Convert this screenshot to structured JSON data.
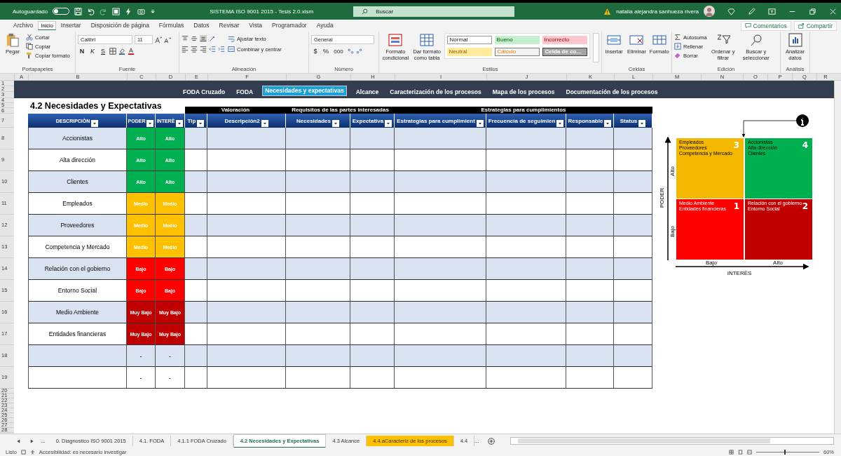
{
  "titlebar": {
    "autosave_label": "Autoguardado",
    "autosave_on": false,
    "title": "SISTEMA ISO 9001 2015 - Tesis 2.0.xlsm",
    "search_placeholder": "Buscar",
    "user": "natalia alejandra sanhueza rivera"
  },
  "menu": {
    "tabs": [
      {
        "label": "Archivo",
        "selected": false
      },
      {
        "label": "Inicio",
        "selected": true
      },
      {
        "label": "Insertar",
        "selected": false
      },
      {
        "label": "Disposición de página",
        "selected": false
      },
      {
        "label": "Fórmulas",
        "selected": false
      },
      {
        "label": "Datos",
        "selected": false
      },
      {
        "label": "Revisar",
        "selected": false
      },
      {
        "label": "Vista",
        "selected": false
      },
      {
        "label": "Programador",
        "selected": false
      },
      {
        "label": "Ayuda",
        "selected": false
      }
    ],
    "comments": "Comentarios",
    "share": "Compartir"
  },
  "ribbon": {
    "clipboard": {
      "paste": "Pegar",
      "cut": "Cortar",
      "copy": "Copiar",
      "format_painter": "Copiar formato",
      "label": "Portapapeles"
    },
    "font": {
      "name": "Calibri",
      "size": "11",
      "bold": "N",
      "italic": "K",
      "underline": "S",
      "label": "Fuente"
    },
    "alignment": {
      "wrap": "Ajustar texto",
      "merge": "Combinar y centrar",
      "label": "Alineación"
    },
    "number": {
      "format": "General",
      "currency": "$",
      "percent": "%",
      "thousands": "000",
      "label": "Número"
    },
    "styles": {
      "conditional": "Formato condicional",
      "as_table": "Dar formato como tabla",
      "label": "Estilos",
      "cells": [
        {
          "label": "Normal",
          "kind": "normal"
        },
        {
          "label": "Bueno",
          "kind": "good"
        },
        {
          "label": "Incorrecto",
          "kind": "bad"
        },
        {
          "label": "Neutral",
          "kind": "neutral"
        },
        {
          "label": "Cálculo",
          "kind": "calc"
        },
        {
          "label": "Celda de co...",
          "kind": "check"
        }
      ]
    },
    "cells": {
      "insert": "Insertar",
      "delete": "Eliminar",
      "format": "Formato",
      "label": "Celdas"
    },
    "editing": {
      "autosum": "Autosuma",
      "fill": "Rellenar",
      "clear": "Borrar",
      "sort": "Ordenar y filtrar",
      "find": "Buscar y seleccionar",
      "label": "Edición"
    },
    "analysis": {
      "analyze": "Analizar datos",
      "label": "Análisis"
    }
  },
  "column_letters": [
    "A",
    "B",
    "C",
    "D",
    "E",
    "F",
    "G",
    "H",
    "I",
    "J",
    "K",
    "L",
    "M",
    "N",
    "O",
    "P",
    "Q",
    "R"
  ],
  "row_numbers": [
    "1",
    "2",
    "3",
    "4",
    "5",
    "6",
    "7",
    "8",
    "9",
    "10",
    "11",
    "12",
    "13",
    "14",
    "15",
    "16",
    "17",
    "18",
    "19",
    "20",
    "21",
    "22",
    "23",
    "24",
    "25",
    "26",
    "27",
    "28"
  ],
  "nav": [
    {
      "label": "FODA Cruzado",
      "selected": false
    },
    {
      "label": "FODA",
      "selected": false
    },
    {
      "label": "Necesidades y expectativas",
      "selected": true
    },
    {
      "label": "Alcance",
      "selected": false
    },
    {
      "label": "Caracterización de los procesos",
      "selected": false
    },
    {
      "label": "Mapa de los procesos",
      "selected": false
    },
    {
      "label": "Documentación de los procesos",
      "selected": false
    }
  ],
  "heading": "4.2 Necesidades y Expectativas",
  "groups": [
    "Valoración",
    "Requisitos de las partes interesadas",
    "Estrategias para cumplimientos"
  ],
  "columns": [
    "DESCRIPCIÒN",
    "PODER",
    "INTERÈ",
    "Tip",
    "Descripciòn2",
    "Necesidades",
    "Expectativa",
    "Estrategias para cumplimient",
    "Frecuencia de seguimien",
    "Responsable",
    "Status"
  ],
  "rows": [
    {
      "description": "Accionistas",
      "poder": {
        "text": "Alto",
        "kind": "alto"
      },
      "interes": {
        "text": "Alto",
        "kind": "alto"
      }
    },
    {
      "description": "Alta dirección",
      "poder": {
        "text": "Alto",
        "kind": "alto"
      },
      "interes": {
        "text": "Alto",
        "kind": "alto"
      }
    },
    {
      "description": "Clientes",
      "poder": {
        "text": "Alto",
        "kind": "alto"
      },
      "interes": {
        "text": "Alto",
        "kind": "alto"
      }
    },
    {
      "description": "Empleados",
      "poder": {
        "text": "Medio",
        "kind": "medio"
      },
      "interes": {
        "text": "Medio",
        "kind": "medio"
      }
    },
    {
      "description": "Proveedores",
      "poder": {
        "text": "Medio",
        "kind": "medio"
      },
      "interes": {
        "text": "Medio",
        "kind": "medio"
      }
    },
    {
      "description": "Competencia y Mercado",
      "poder": {
        "text": "Medio",
        "kind": "medio"
      },
      "interes": {
        "text": "Medio",
        "kind": "medio"
      }
    },
    {
      "description": "Relación con el gobierno",
      "poder": {
        "text": "Bajo",
        "kind": "bajo"
      },
      "interes": {
        "text": "Bajo",
        "kind": "bajo"
      }
    },
    {
      "description": "Entorno Social",
      "poder": {
        "text": "Bajo",
        "kind": "bajo"
      },
      "interes": {
        "text": "Bajo",
        "kind": "bajo"
      }
    },
    {
      "description": "Medio Ambiente",
      "poder": {
        "text": "Muy Bajo",
        "kind": "muy_bajo"
      },
      "interes": {
        "text": "Muy Bajo",
        "kind": "muy_bajo"
      }
    },
    {
      "description": "Entidades financieras",
      "poder": {
        "text": "Muy Bajo",
        "kind": "muy_bajo"
      },
      "interes": {
        "text": "Muy Bajo",
        "kind": "muy_bajo"
      }
    },
    {
      "poder": {
        "text": "-",
        "kind": "none"
      },
      "interes": {
        "text": "-",
        "kind": "none"
      }
    },
    {
      "poder": {
        "text": "-",
        "kind": "none"
      },
      "interes": {
        "text": "-",
        "kind": "none"
      }
    }
  ],
  "matrix": {
    "y_axis": "PODER",
    "y_high": "Alto",
    "y_low": "Bajo",
    "x_axis": "INTERÈS",
    "x_low": "Bajo",
    "x_high": "Alto",
    "quadrants": [
      {
        "number": "3",
        "color": "#f5b800",
        "items": [
          "Empleados",
          "Proveedores",
          "Competencia y Mercado"
        ]
      },
      {
        "number": "4",
        "color": "#00b050",
        "items": [
          "Accionistas",
          "Alta dirección",
          "Clientes"
        ]
      },
      {
        "number": "1",
        "color": "#ff0000",
        "items": [
          "Medio Ambiente",
          "Entidades financieras"
        ]
      },
      {
        "number": "2",
        "color": "#c00000",
        "items": [
          "Relación con el gobierno",
          "Entorno Social"
        ]
      }
    ]
  },
  "sheet_tabs": {
    "more_left": "...",
    "more_right": "...",
    "tabs": [
      {
        "label": "0. Diagnostico ISO 9001 2015",
        "selected": false
      },
      {
        "label": "4.1. FODA",
        "selected": false
      },
      {
        "label": "4.1.1 FODA Cruzado",
        "selected": false
      },
      {
        "label": "4.2 Necesidades y Expectativas",
        "selected": true
      },
      {
        "label": "4.3 Alcance",
        "selected": false
      },
      {
        "label": "4.4.aCaracteriz de los procesos",
        "selected": false,
        "color": "#ffc000"
      },
      {
        "label": "4.4",
        "selected": false
      }
    ]
  },
  "status": {
    "ready": "Listo",
    "accessibility": "Accesibilidad: es necesario investigar",
    "zoom": "60%",
    "level": 0.45
  }
}
